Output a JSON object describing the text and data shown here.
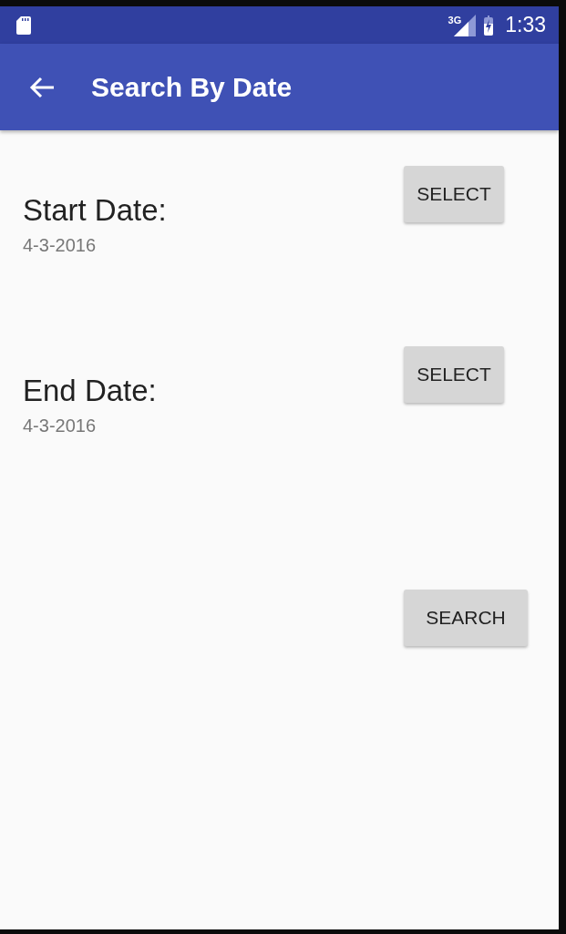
{
  "status_bar": {
    "network": "3G",
    "time": "1:33"
  },
  "app_bar": {
    "title": "Search By Date"
  },
  "date_fields": [
    {
      "label": "Start Date:",
      "value": "4-3-2016",
      "button": "SELECT"
    },
    {
      "label": "End Date:",
      "value": "4-3-2016",
      "button": "SELECT"
    }
  ],
  "search_button": "SEARCH"
}
